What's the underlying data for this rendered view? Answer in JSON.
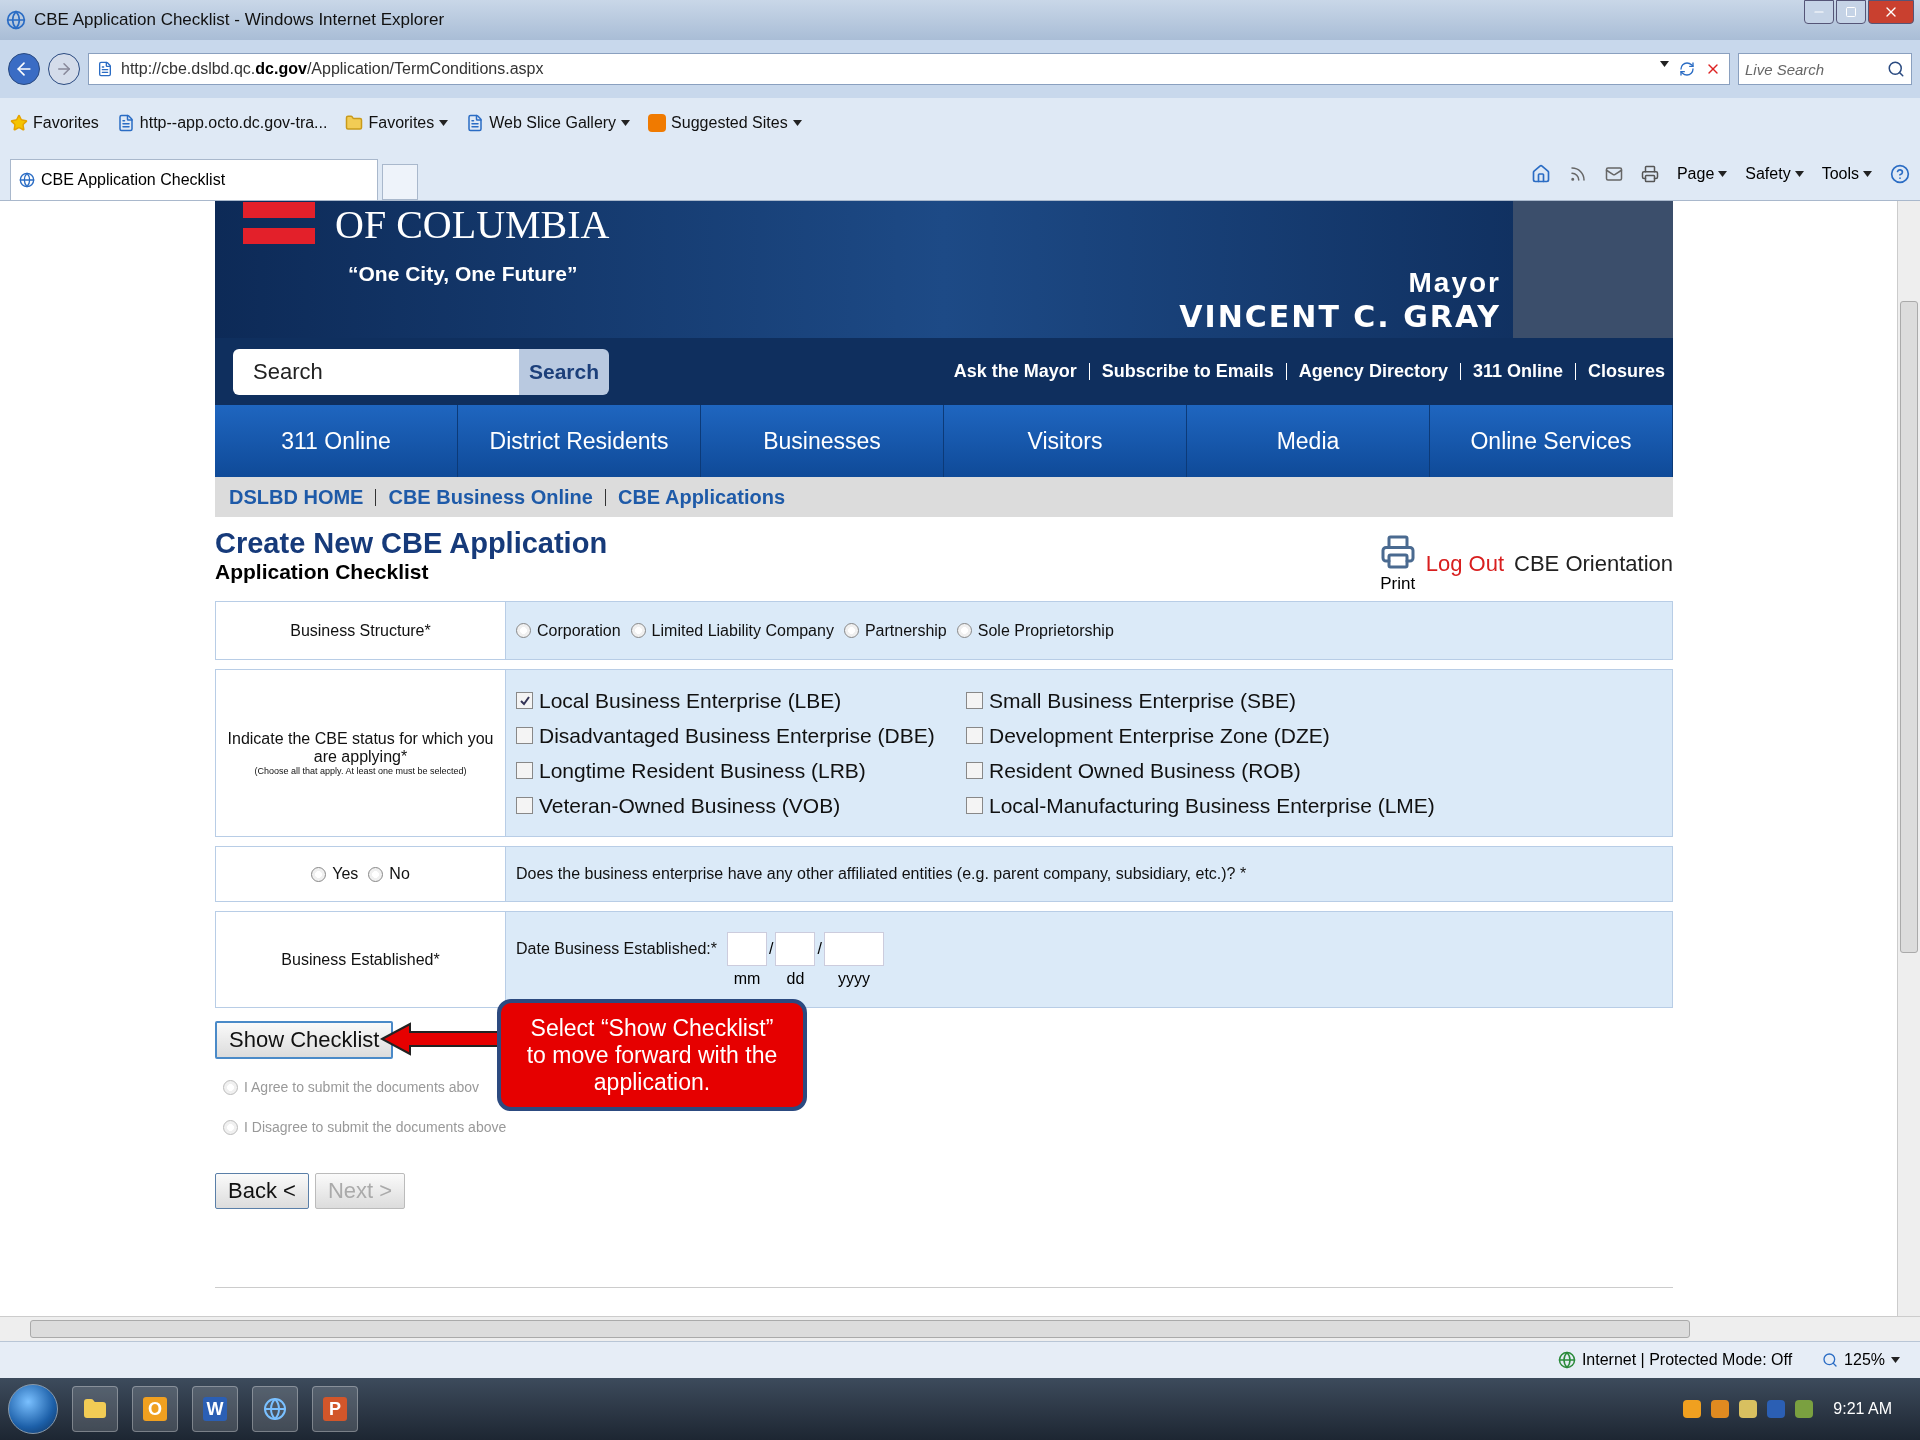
{
  "browser": {
    "title": "CBE Application Checklist - Windows Internet Explorer",
    "address": "http://cbe.dslbd.qc.**dc.gov**/Application/TermConditions.aspx",
    "search_placeholder": "Live Search",
    "favorites_bar": [
      {
        "kind": "favorites",
        "label": "Favorites",
        "dropdown": false
      },
      {
        "kind": "page",
        "label": "http--app.octo.dc.gov-tra...",
        "dropdown": false
      },
      {
        "kind": "folder",
        "label": "Favorites",
        "dropdown": true
      },
      {
        "kind": "page",
        "label": "Web Slice Gallery",
        "dropdown": true
      },
      {
        "kind": "sites",
        "label": "Suggested Sites",
        "dropdown": true
      }
    ],
    "tab": "CBE Application Checklist",
    "commands": [
      "Page",
      "Safety",
      "Tools"
    ]
  },
  "page": {
    "banner": {
      "city": "OF COLUMBIA",
      "slogan": "“One City, One Future”",
      "mayor_title": "Mayor",
      "mayor_name": "VINCENT C. GRAY"
    },
    "search": {
      "placeholder": "Search",
      "button": "Search"
    },
    "utility_links": [
      "Ask the Mayor",
      "Subscribe to Emails",
      "Agency Directory",
      "311 Online",
      "Closures"
    ],
    "nav": [
      "311 Online",
      "District Residents",
      "Businesses",
      "Visitors",
      "Media",
      "Online Services"
    ],
    "breadcrumb": [
      "DSLBD HOME",
      "CBE Business Online",
      "CBE Applications"
    ],
    "heading": "Create New CBE Application",
    "subheading": "Application Checklist",
    "print": "Print",
    "logout": "Log Out",
    "orientation": "CBE Orientation",
    "structure": {
      "label": "Business Structure*",
      "options": [
        {
          "label": "Corporation",
          "selected": false
        },
        {
          "label": "Limited Liability Company",
          "selected": false
        },
        {
          "label": "Partnership",
          "selected": false
        },
        {
          "label": "Sole Proprietorship",
          "selected": false
        }
      ]
    },
    "status": {
      "label": "Indicate the CBE status for which you are applying*",
      "note": "(Choose all that apply. At least one must be selected)",
      "options": [
        {
          "label": "Local Business Enterprise (LBE)",
          "checked": true
        },
        {
          "label": "Small Business Enterprise (SBE)",
          "checked": false
        },
        {
          "label": "Disadvantaged Business Enterprise (DBE)",
          "checked": false
        },
        {
          "label": "Development Enterprise Zone (DZE)",
          "checked": false
        },
        {
          "label": "Longtime Resident Business (LRB)",
          "checked": false
        },
        {
          "label": "Resident Owned Business (ROB)",
          "checked": false
        },
        {
          "label": "Veteran-Owned Business (VOB)",
          "checked": false
        },
        {
          "label": "Local-Manufacturing Business Enterprise (LME)",
          "checked": false
        }
      ]
    },
    "affiliates": {
      "options": [
        {
          "label": "Yes",
          "selected": false
        },
        {
          "label": "No",
          "selected": false
        }
      ],
      "question": "Does the business enterprise have any other affiliated entities (e.g. parent company, subsidiary, etc.)? *"
    },
    "established": {
      "label": "Business Established*",
      "field_label": "Date Business Established:*",
      "parts": [
        {
          "caption": "mm",
          "separator": "/"
        },
        {
          "caption": "dd",
          "separator": "/"
        },
        {
          "caption": "yyyy"
        }
      ]
    },
    "show_checklist": "Show Checklist",
    "agreements": [
      {
        "label": "I Agree to submit the documents abov",
        "selected": false,
        "disabled": true
      },
      {
        "label": "I Disagree to submit the documents above",
        "selected": false,
        "disabled": true
      }
    ],
    "buttons": [
      {
        "label": "Back <",
        "disabled": false
      },
      {
        "label": "Next >",
        "disabled": true
      }
    ],
    "callout": "Select “Show Checklist” to move forward with the application."
  },
  "status_bar": {
    "zone": "Internet | Protected Mode: Off",
    "zoom": "125%"
  },
  "taskbar": {
    "apps": [
      {
        "kind": "folder"
      },
      {
        "kind": "letter",
        "label": "O",
        "color": "#f0a020"
      },
      {
        "kind": "letter",
        "label": "W",
        "color": "#2b5fb4"
      },
      {
        "kind": "browser"
      },
      {
        "kind": "letter",
        "label": "P",
        "color": "#d2562a"
      }
    ],
    "clock": "9:21 AM"
  }
}
